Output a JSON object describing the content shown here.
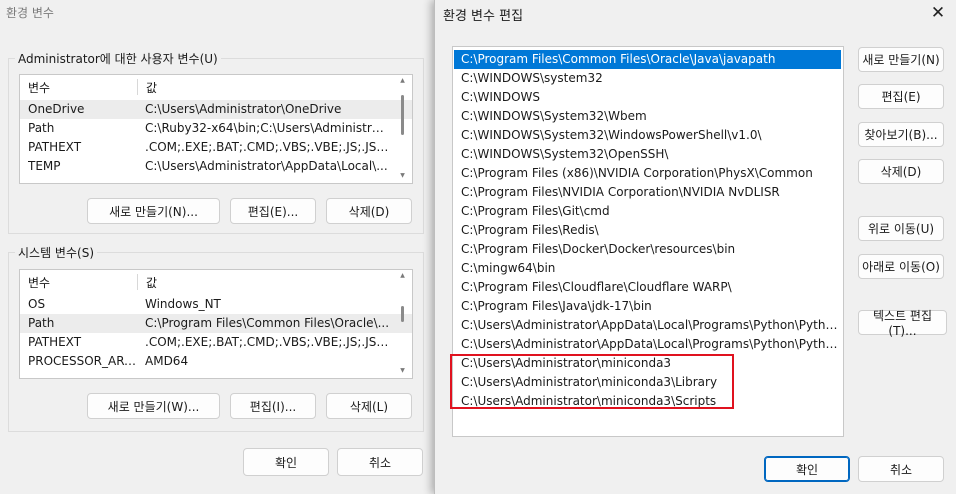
{
  "bg_dialog": {
    "title": "환경 변수",
    "user_group": {
      "legend": "Administrator에 대한 사용자 변수(U)",
      "columns": [
        "변수",
        "값"
      ],
      "rows": [
        {
          "var": "OneDrive",
          "val": "C:\\Users\\Administrator\\OneDrive"
        },
        {
          "var": "Path",
          "val": "C:\\Ruby32-x64\\bin;C:\\Users\\Administrat..."
        },
        {
          "var": "PATHEXT",
          "val": ".COM;.EXE;.BAT;.CMD;.VBS;.VBE;.JS;.JSE;.W..."
        },
        {
          "var": "TEMP",
          "val": "C:\\Users\\Administrator\\AppData\\Local\\..."
        }
      ],
      "selected_index": 0,
      "buttons": {
        "new": "새로 만들기(N)...",
        "edit": "편집(E)...",
        "delete": "삭제(D)"
      }
    },
    "system_group": {
      "legend": "시스템 변수(S)",
      "columns": [
        "변수",
        "값"
      ],
      "rows": [
        {
          "var": "OS",
          "val": "Windows_NT"
        },
        {
          "var": "Path",
          "val": "C:\\Program Files\\Common Files\\Oracle\\..."
        },
        {
          "var": "PATHEXT",
          "val": ".COM;.EXE;.BAT;.CMD;.VBS;.VBE;.JS;.JSE;.W..."
        },
        {
          "var": "PROCESSOR_ARC...",
          "val": "AMD64"
        }
      ],
      "selected_index": 1,
      "buttons": {
        "new": "새로 만들기(W)...",
        "edit": "편집(I)...",
        "delete": "삭제(L)"
      }
    },
    "ok": "확인",
    "cancel": "취소"
  },
  "fg_dialog": {
    "title": "환경 변수 편집",
    "close_icon": "close-icon",
    "paths": [
      "C:\\Program Files\\Common Files\\Oracle\\Java\\javapath",
      "C:\\WINDOWS\\system32",
      "C:\\WINDOWS",
      "C:\\WINDOWS\\System32\\Wbem",
      "C:\\WINDOWS\\System32\\WindowsPowerShell\\v1.0\\",
      "C:\\WINDOWS\\System32\\OpenSSH\\",
      "C:\\Program Files (x86)\\NVIDIA Corporation\\PhysX\\Common",
      "C:\\Program Files\\NVIDIA Corporation\\NVIDIA NvDLISR",
      "C:\\Program Files\\Git\\cmd",
      "C:\\Program Files\\Redis\\",
      "C:\\Program Files\\Docker\\Docker\\resources\\bin",
      "C:\\mingw64\\bin",
      "C:\\Program Files\\Cloudflare\\Cloudflare WARP\\",
      "C:\\Program Files\\Java\\jdk-17\\bin",
      "C:\\Users\\Administrator\\AppData\\Local\\Programs\\Python\\Pytho...",
      "C:\\Users\\Administrator\\AppData\\Local\\Programs\\Python\\Pytho...",
      "C:\\Users\\Administrator\\miniconda3",
      "C:\\Users\\Administrator\\miniconda3\\Library",
      "C:\\Users\\Administrator\\miniconda3\\Scripts"
    ],
    "selected_index": 0,
    "highlight_color": "#e0121f",
    "selection_color": "#0078d7",
    "buttons": {
      "new": "새로 만들기(N)",
      "edit": "편집(E)",
      "browse": "찾아보기(B)...",
      "delete": "삭제(D)",
      "move_up": "위로 이동(U)",
      "move_down": "아래로 이동(O)",
      "edit_text": "텍스트 편집(T)..."
    },
    "ok": "확인",
    "cancel": "취소"
  }
}
